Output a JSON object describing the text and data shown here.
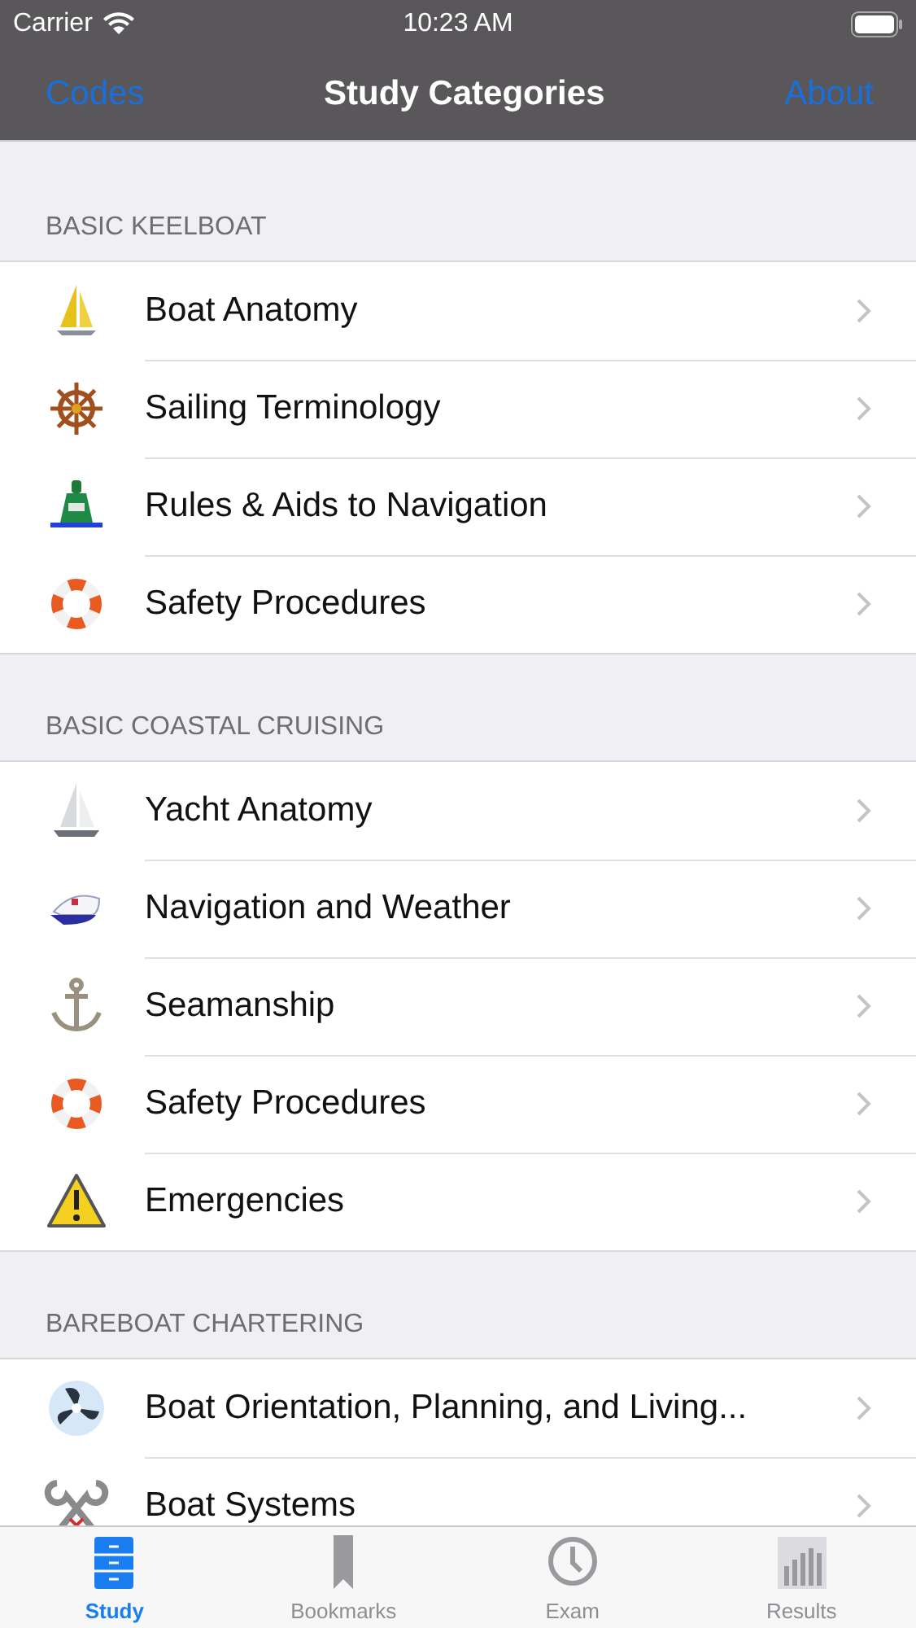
{
  "status_bar": {
    "carrier": "Carrier",
    "time": "10:23 AM"
  },
  "nav_bar": {
    "left_button": "Codes",
    "title": "Study Categories",
    "right_button": "About"
  },
  "sections": [
    {
      "header": "BASIC KEELBOAT",
      "rows": [
        {
          "label": "Boat Anatomy",
          "kind": "sailboat"
        },
        {
          "label": "Sailing Terminology",
          "kind": "wheel"
        },
        {
          "label": "Rules & Aids to Navigation",
          "kind": "buoy"
        },
        {
          "label": "Safety Procedures",
          "kind": "lifering"
        }
      ]
    },
    {
      "header": "BASIC COASTAL CRUISING",
      "rows": [
        {
          "label": "Yacht Anatomy",
          "kind": "yacht"
        },
        {
          "label": "Navigation and Weather",
          "kind": "cap"
        },
        {
          "label": "Seamanship",
          "kind": "anchor"
        },
        {
          "label": "Safety Procedures",
          "kind": "lifering"
        },
        {
          "label": "Emergencies",
          "kind": "warning"
        }
      ]
    },
    {
      "header": "BAREBOAT CHARTERING",
      "rows": [
        {
          "label": "Boat Orientation, Planning, and Living...",
          "kind": "propeller"
        },
        {
          "label": "Boat Systems",
          "kind": "wrench"
        }
      ]
    }
  ],
  "tab_bar": [
    {
      "label": "Study",
      "kind": "cabinet",
      "selected": true
    },
    {
      "label": "Bookmarks",
      "kind": "bookmark",
      "selected": false
    },
    {
      "label": "Exam",
      "kind": "clock",
      "selected": false
    },
    {
      "label": "Results",
      "kind": "chart",
      "selected": false
    }
  ]
}
